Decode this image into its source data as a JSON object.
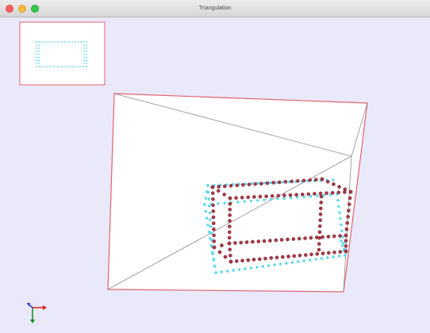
{
  "window": {
    "title": "Triangulation"
  },
  "colors": {
    "background": "#e9e9fa",
    "frame_border": "#e4606e",
    "wireframe_points_red": "#a83848",
    "wireframe_points_cyan": "#5ad8ee",
    "triangle_edges": "#8e8e8e",
    "axis_x": "#e02020",
    "axis_y": "#1a8a1a",
    "axis_z": "#1a2ae8"
  },
  "icons": {
    "close": "red-traffic-light-icon",
    "minimize": "yellow-traffic-light-icon",
    "maximize": "green-traffic-light-icon",
    "axes": "xyz-axes-gizmo-icon"
  }
}
